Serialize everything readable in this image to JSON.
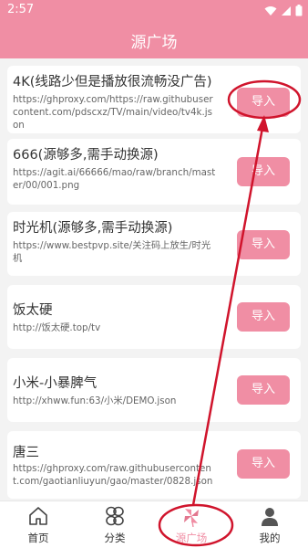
{
  "status": {
    "time": "2:57"
  },
  "header": {
    "title": "源广场"
  },
  "sources": [
    {
      "name": "4K(线路少但是播放很流畅没广告)",
      "url": "https://ghproxy.com/https://raw.githubusercontent.com/pdscxz/TV/main/video/tv4k.json",
      "import_label": "导入"
    },
    {
      "name": "666(源够多,需手动换源)",
      "url": "https://agit.ai/66666/mao/raw/branch/master/00/001.png",
      "import_label": "导入"
    },
    {
      "name": "时光机(源够多,需手动换源)",
      "url": "https://www.bestpvp.site/关注码上放生/时光机",
      "import_label": "导入"
    },
    {
      "name": "饭太硬",
      "url": "http://饭太硬.top/tv",
      "import_label": "导入"
    },
    {
      "name": "小米-小暴脾气",
      "url": "http://xhww.fun:63/小米/DEMO.json",
      "import_label": "导入"
    },
    {
      "name": "唐三",
      "url": "https://ghproxy.com/raw.githubusercontent.com/gaotianliuyun/gao/master/0828.json",
      "import_label": "导入"
    }
  ],
  "nav": [
    {
      "label": "首页",
      "icon": "home-icon"
    },
    {
      "label": "分类",
      "icon": "category-icon"
    },
    {
      "label": "源广场",
      "icon": "pinwheel-icon",
      "active": true
    },
    {
      "label": "我的",
      "icon": "user-icon"
    }
  ],
  "colors": {
    "accent": "#f08ea4",
    "annotation": "#d0142c"
  }
}
